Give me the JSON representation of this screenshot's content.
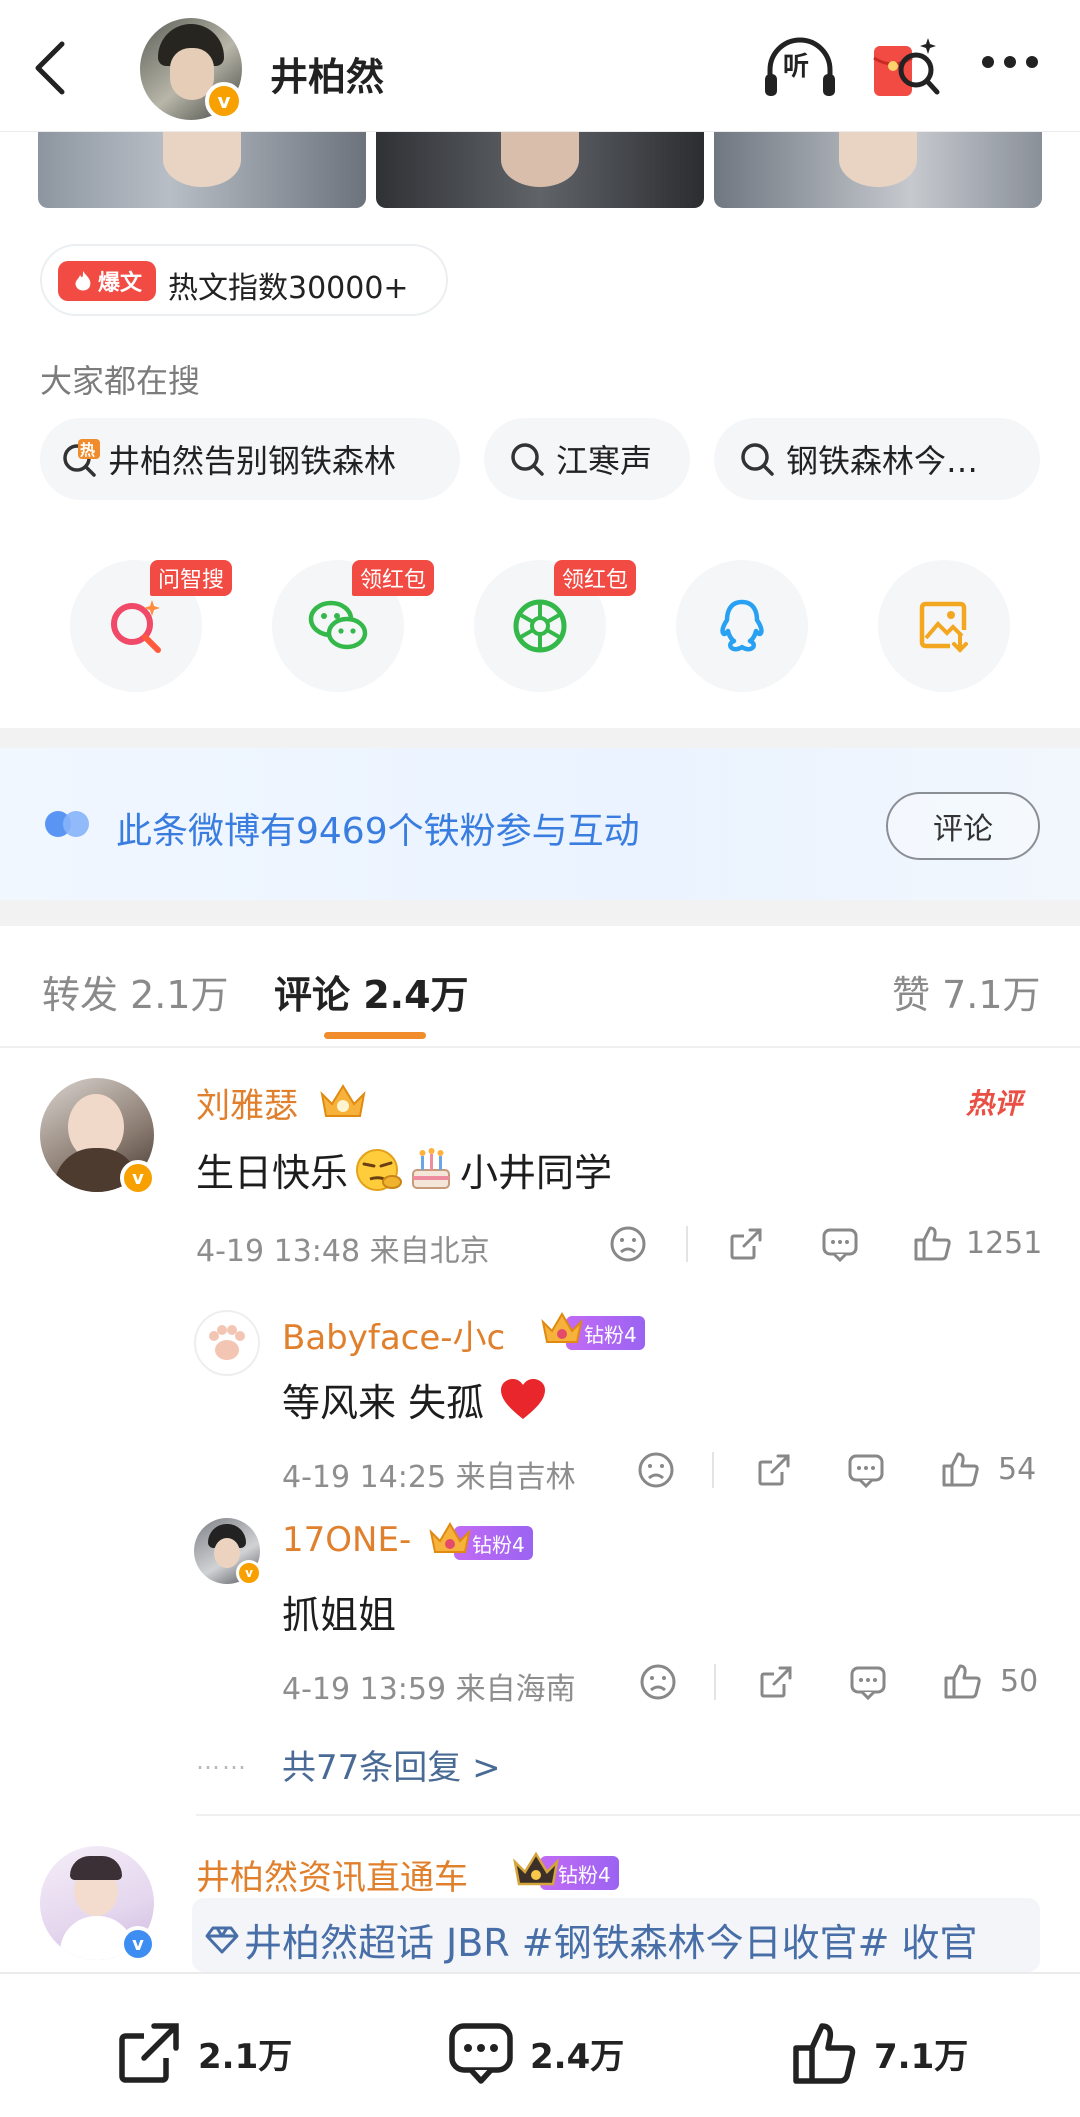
{
  "header": {
    "title": "井柏然",
    "listen_label": "听",
    "verified_mark": "v",
    "icons": [
      "back-icon",
      "headphone-icon",
      "red-packet-search-icon",
      "more-icon"
    ]
  },
  "hot_article": {
    "tag": "爆文",
    "label": "热文指数30000+"
  },
  "searches": {
    "heading": "大家都在搜",
    "items": [
      {
        "label": "井柏然告别钢铁森林",
        "hot_mark": "热"
      },
      {
        "label": "江寒声"
      },
      {
        "label": "钢铁森林今…"
      }
    ]
  },
  "share_row": {
    "items": [
      {
        "icon": "wenzhisou-icon",
        "tag": "问智搜"
      },
      {
        "icon": "wechat-icon",
        "tag": "领红包"
      },
      {
        "icon": "moments-icon",
        "tag": "领红包"
      },
      {
        "icon": "qq-icon"
      },
      {
        "icon": "save-image-icon"
      }
    ]
  },
  "fan_banner": {
    "text": "此条微博有9469个铁粉参与互动",
    "button": "评论"
  },
  "tabs": {
    "repost": "转发 2.1万",
    "comment": "评论 2.4万",
    "like": "赞 7.1万"
  },
  "comments": [
    {
      "name": "刘雅瑟",
      "text_a": "生日快乐",
      "text_b": "小井同学",
      "time": "4-19 13:48",
      "location": "来自北京",
      "likes": "1251",
      "hot_tag": "热评",
      "replies": [
        {
          "name": "Babyface-小c",
          "badge": "钻粉4",
          "text": "等风来 失孤",
          "time": "4-19 14:25",
          "location": "来自吉林",
          "likes": "54"
        },
        {
          "name": "17ONE-",
          "badge": "钻粉4",
          "text": "抓姐姐",
          "time": "4-19 13:59",
          "location": "来自海南",
          "likes": "50"
        }
      ],
      "more_dots": "……",
      "more_replies": "共77条回复 >"
    },
    {
      "name": "井柏然资讯直通车",
      "badge": "钻粉4",
      "topic": "井柏然超话",
      "text": "JBR #钢铁森林今日收官# 收官"
    }
  ],
  "bottom_bar": {
    "repost": "2.1万",
    "comment": "2.4万",
    "like": "7.1万"
  },
  "colors": {
    "accent": "#f08c2b",
    "name": "#e0802d",
    "link": "#486ea8",
    "fan_blue": "#3a7de0",
    "red": "#f14b44"
  }
}
